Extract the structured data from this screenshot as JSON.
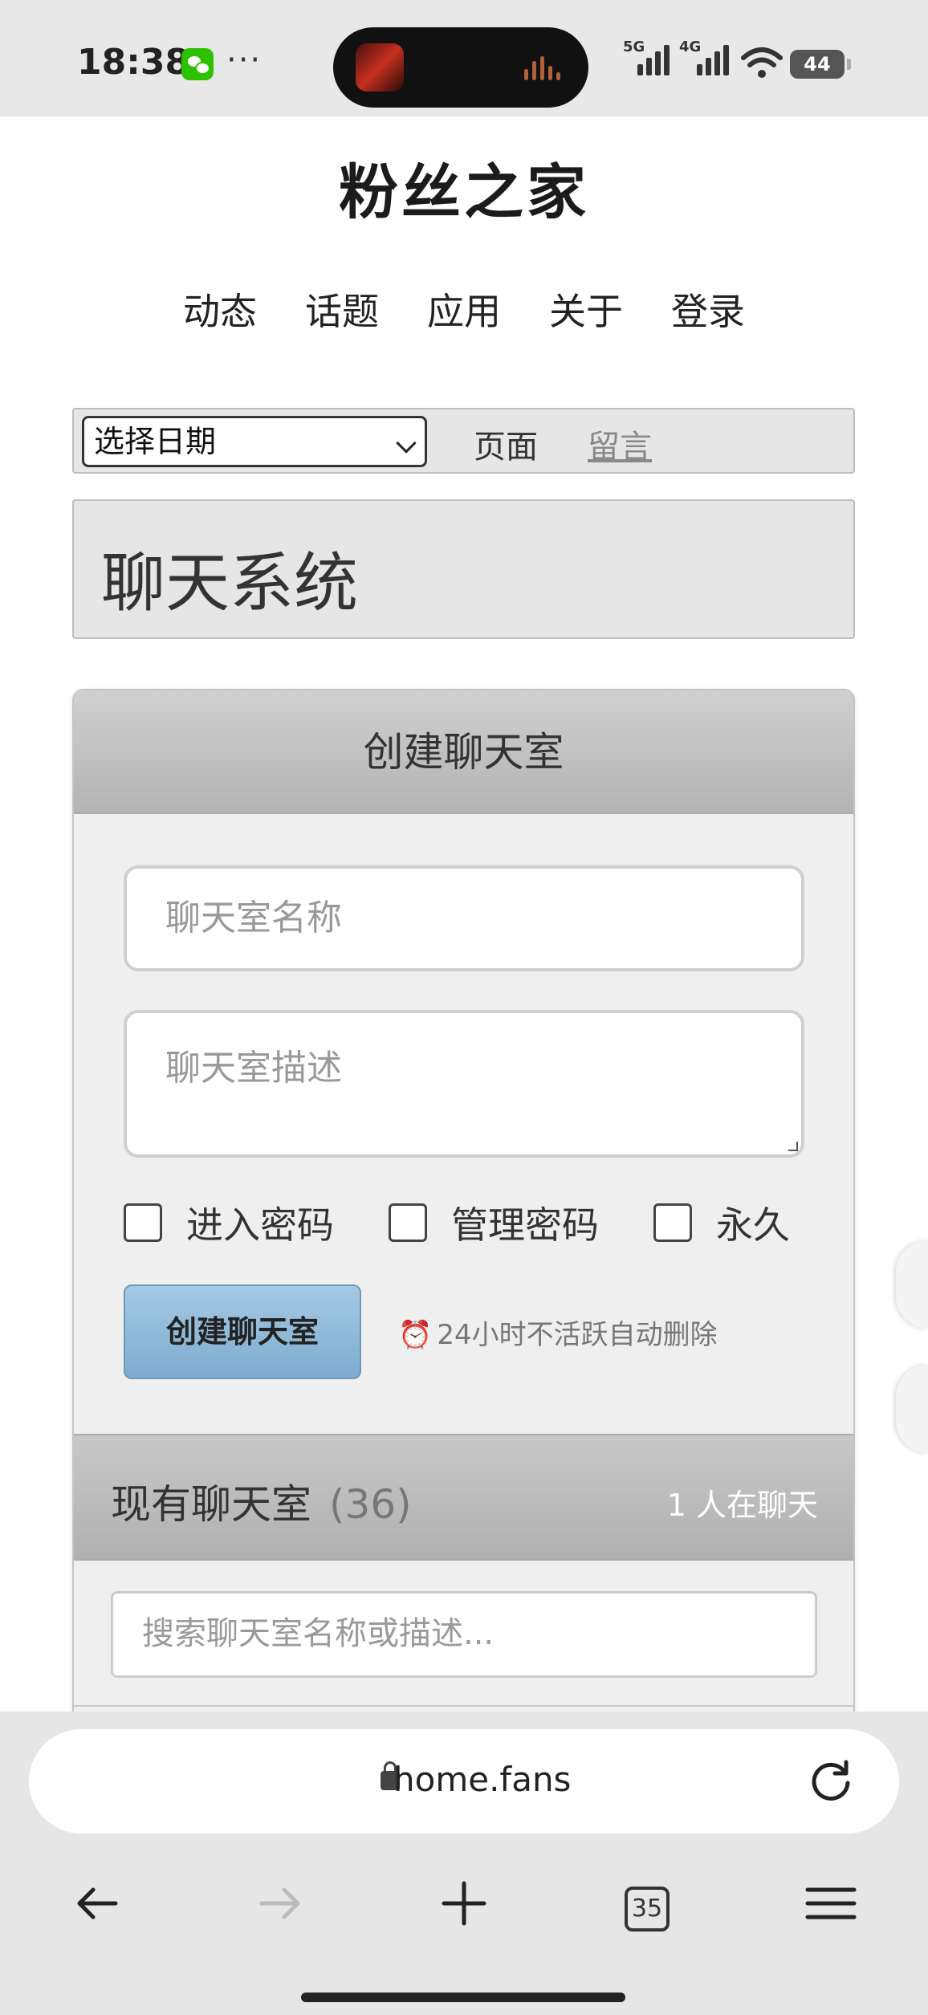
{
  "status_bar": {
    "time": "18:38",
    "signal1_label": "5G",
    "signal2_label": "4G",
    "battery": "44"
  },
  "header": {
    "site_title": "粉丝之家",
    "nav": [
      "动态",
      "话题",
      "应用",
      "关于",
      "登录"
    ]
  },
  "toolbar": {
    "date_select": "选择日期",
    "link_page": "页面",
    "link_message": "留言"
  },
  "page_heading": "聊天系统",
  "create_room": {
    "title": "创建聊天室",
    "name_placeholder": "聊天室名称",
    "desc_placeholder": "聊天室描述",
    "options": [
      "进入密码",
      "管理密码",
      "永久"
    ],
    "create_button": "创建聊天室",
    "hint_icon": "⏰",
    "hint": "24小时不活跃自动删除"
  },
  "room_list": {
    "title": "现有聊天室",
    "count": "(36)",
    "online": "1 人在聊天",
    "search_placeholder": "搜索聊天室名称或描述..."
  },
  "browser": {
    "url": "home.fans",
    "tab_count": "35"
  },
  "colors": {
    "button_blue": "#8fb8d8",
    "header_gray": "#bdbdbd",
    "wechat_green": "#2dc100"
  }
}
